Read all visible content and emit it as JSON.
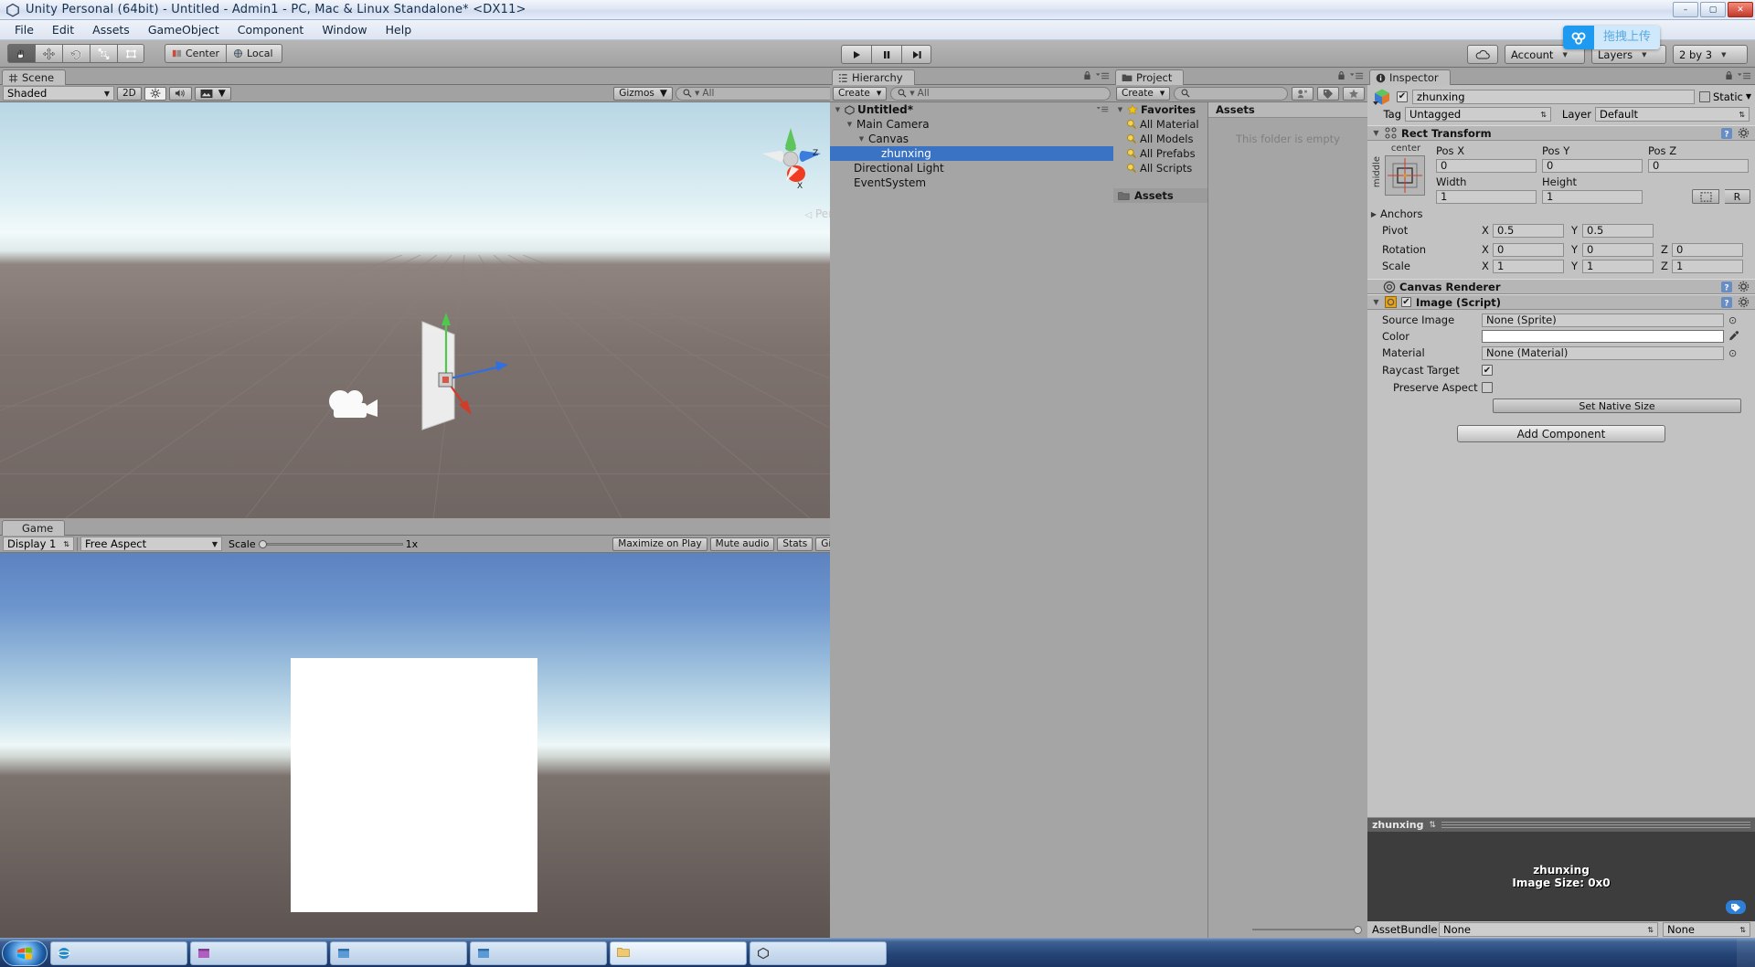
{
  "window": {
    "title": "Unity Personal (64bit) - Untitled - Admin1 - PC, Mac & Linux Standalone* <DX11>",
    "minimize": "–",
    "maximize": "▢",
    "close": "✕"
  },
  "menubar": {
    "items": [
      "File",
      "Edit",
      "Assets",
      "GameObject",
      "Component",
      "Window",
      "Help"
    ]
  },
  "toolbar": {
    "transform_tools": [
      "hand-tool",
      "move-tool",
      "rotate-tool",
      "scale-tool",
      "rect-tool"
    ],
    "pivot_mode": "Center",
    "pivot_rotation": "Local",
    "play": "▶",
    "pause": "❚❚",
    "step": "▶❙",
    "cloud": "cloud-icon",
    "account": "Account",
    "layers": "Layers",
    "layout": "2 by 3",
    "upload_badge": "拖拽上传"
  },
  "scene": {
    "tab": "Scene",
    "draw_mode": "Shaded",
    "two_d": "2D",
    "lighting": "light-toggle",
    "audio": "audio-toggle",
    "fx": "effects-toggle",
    "gizmos": "Gizmos",
    "search_placeholder": "All",
    "projection_label": "Persp",
    "axis_z": "Z",
    "axis_x": "X"
  },
  "game": {
    "tab": "Game",
    "display": "Display 1",
    "aspect": "Free Aspect",
    "scale_label": "Scale",
    "scale_value": "1x",
    "maximize_on_play": "Maximize on Play",
    "mute_audio": "Mute audio",
    "stats": "Stats",
    "gizmos": "Gizmos"
  },
  "hierarchy": {
    "tab": "Hierarchy",
    "create": "Create",
    "search_placeholder": "All",
    "items": [
      {
        "label": "Untitled*",
        "depth": 0,
        "arrow": "▼",
        "root": true,
        "selected": false
      },
      {
        "label": "Main Camera",
        "depth": 1,
        "arrow": "▼",
        "root": false,
        "selected": false
      },
      {
        "label": "Canvas",
        "depth": 2,
        "arrow": "▼",
        "root": false,
        "selected": false
      },
      {
        "label": "zhunxing",
        "depth": 4,
        "arrow": "",
        "root": false,
        "selected": true
      },
      {
        "label": "Directional Light",
        "depth": 1,
        "arrow": "",
        "root": false,
        "selected": false
      },
      {
        "label": "EventSystem",
        "depth": 1,
        "arrow": "",
        "root": false,
        "selected": false
      }
    ]
  },
  "project": {
    "tab": "Project",
    "create": "Create",
    "search_placeholder": "",
    "favorites_label": "Favorites",
    "favorites": [
      "All Material",
      "All Models",
      "All Prefabs",
      "All Scripts"
    ],
    "assets_label": "Assets",
    "content_header": "Assets",
    "empty_message": "This folder is empty"
  },
  "inspector": {
    "tab": "Inspector",
    "object_name": "zhunxing",
    "enabled": true,
    "static_label": "Static",
    "tag_label": "Tag",
    "tag_value": "Untagged",
    "layer_label": "Layer",
    "layer_value": "Default",
    "rect_transform": {
      "title": "Rect Transform",
      "anchor_preset_h": "center",
      "anchor_preset_v": "middle",
      "pos_x_label": "Pos X",
      "pos_y_label": "Pos Y",
      "pos_z_label": "Pos Z",
      "pos_x": "0",
      "pos_y": "0",
      "pos_z": "0",
      "width_label": "Width",
      "height_label": "Height",
      "width": "1",
      "height": "1",
      "blueprint_btn": "blueprint-mode-icon",
      "raw_btn": "R",
      "anchors_label": "Anchors",
      "pivot_label": "Pivot",
      "pivot_x": "0.5",
      "pivot_y": "0.5",
      "rotation_label": "Rotation",
      "rotation_x": "0",
      "rotation_y": "0",
      "rotation_z": "0",
      "scale_label": "Scale",
      "scale_x": "1",
      "scale_y": "1",
      "scale_z": "1",
      "axis_x": "X",
      "axis_y": "Y",
      "axis_z": "Z"
    },
    "canvas_renderer": {
      "title": "Canvas Renderer"
    },
    "image_script": {
      "title": "Image (Script)",
      "enabled": true,
      "source_image_label": "Source Image",
      "source_image_value": "None (Sprite)",
      "color_label": "Color",
      "color_value": "#FFFFFF",
      "material_label": "Material",
      "material_value": "None (Material)",
      "raycast_target_label": "Raycast Target",
      "raycast_target": true,
      "preserve_aspect_label": "Preserve Aspect",
      "preserve_aspect": false,
      "set_native_size": "Set Native Size"
    },
    "add_component": "Add Component",
    "preview": {
      "name": "zhunxing",
      "title": "zhunxing",
      "image_size": "Image Size: 0x0"
    },
    "assetbundle_label": "AssetBundle",
    "assetbundle_value": "None",
    "assetbundle_variant": "None"
  },
  "taskbar": {
    "items": [
      {
        "label": "",
        "icon": "ie-icon"
      },
      {
        "label": "",
        "icon": "window-icon"
      },
      {
        "label": "",
        "icon": "window-icon"
      },
      {
        "label": "",
        "icon": "folder-icon"
      },
      {
        "label": "",
        "icon": "unity-icon"
      },
      {
        "label": "",
        "icon": "window-icon"
      }
    ]
  }
}
